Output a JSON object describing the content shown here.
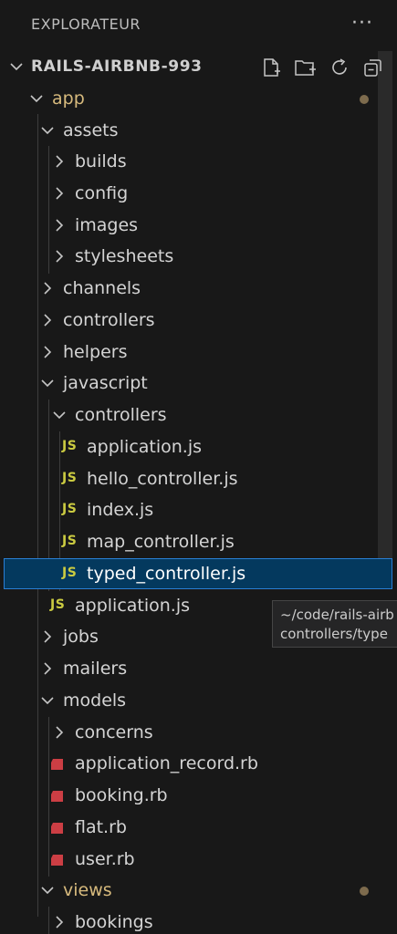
{
  "header": {
    "title": "EXPLORATEUR",
    "more": "···"
  },
  "tree": {
    "root": "RAILS-AIRBNB-993",
    "app": "app",
    "assets": "assets",
    "builds": "builds",
    "config": "config",
    "images": "images",
    "stylesheets": "stylesheets",
    "channels": "channels",
    "controllers": "controllers",
    "helpers": "helpers",
    "javascript": "javascript",
    "js_controllers": "controllers",
    "application_js": "application.js",
    "hello_controller_js": "hello_controller.js",
    "index_js": "index.js",
    "map_controller_js": "map_controller.js",
    "typed_controller_js": "typed_controller.js",
    "js_application_js": "application.js",
    "jobs": "jobs",
    "mailers": "mailers",
    "models": "models",
    "concerns": "concerns",
    "application_record_rb": "application_record.rb",
    "booking_rb": "booking.rb",
    "flat_rb": "flat.rb",
    "user_rb": "user.rb",
    "views": "views",
    "bookings": "bookings"
  },
  "icons": {
    "js_badge": "JS"
  },
  "tooltip": {
    "line1": "~/code/rails-airb",
    "line2": "controllers/type"
  },
  "colors": {
    "background": "#181818",
    "selection": "#04395e",
    "js_icon": "#cbcb41",
    "ruby_icon": "#cc3e44",
    "modified_dot": "#7d6b4d"
  }
}
